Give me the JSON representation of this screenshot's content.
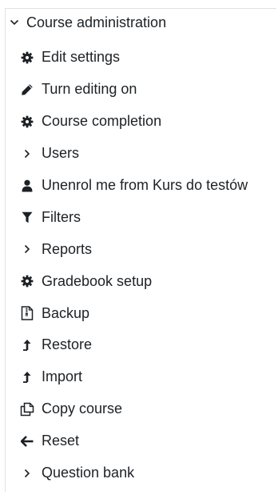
{
  "block": {
    "title": "Course administration",
    "title_icon": "chevron-down-icon",
    "items": [
      {
        "label": "Edit settings",
        "icon": "gear-icon"
      },
      {
        "label": "Turn editing on",
        "icon": "pencil-icon"
      },
      {
        "label": "Course completion",
        "icon": "gear-icon"
      },
      {
        "label": "Users",
        "icon": "chevron-right-icon"
      },
      {
        "label": "Unenrol me from Kurs do testów",
        "icon": "user-icon"
      },
      {
        "label": "Filters",
        "icon": "filter-icon"
      },
      {
        "label": "Reports",
        "icon": "chevron-right-icon"
      },
      {
        "label": "Gradebook setup",
        "icon": "gear-icon"
      },
      {
        "label": "Backup",
        "icon": "backup-file-icon"
      },
      {
        "label": "Restore",
        "icon": "upload-arrow-icon"
      },
      {
        "label": "Import",
        "icon": "upload-arrow-icon"
      },
      {
        "label": "Copy course",
        "icon": "copy-icon"
      },
      {
        "label": "Reset",
        "icon": "arrow-left-icon"
      },
      {
        "label": "Question bank",
        "icon": "chevron-right-icon"
      }
    ]
  }
}
